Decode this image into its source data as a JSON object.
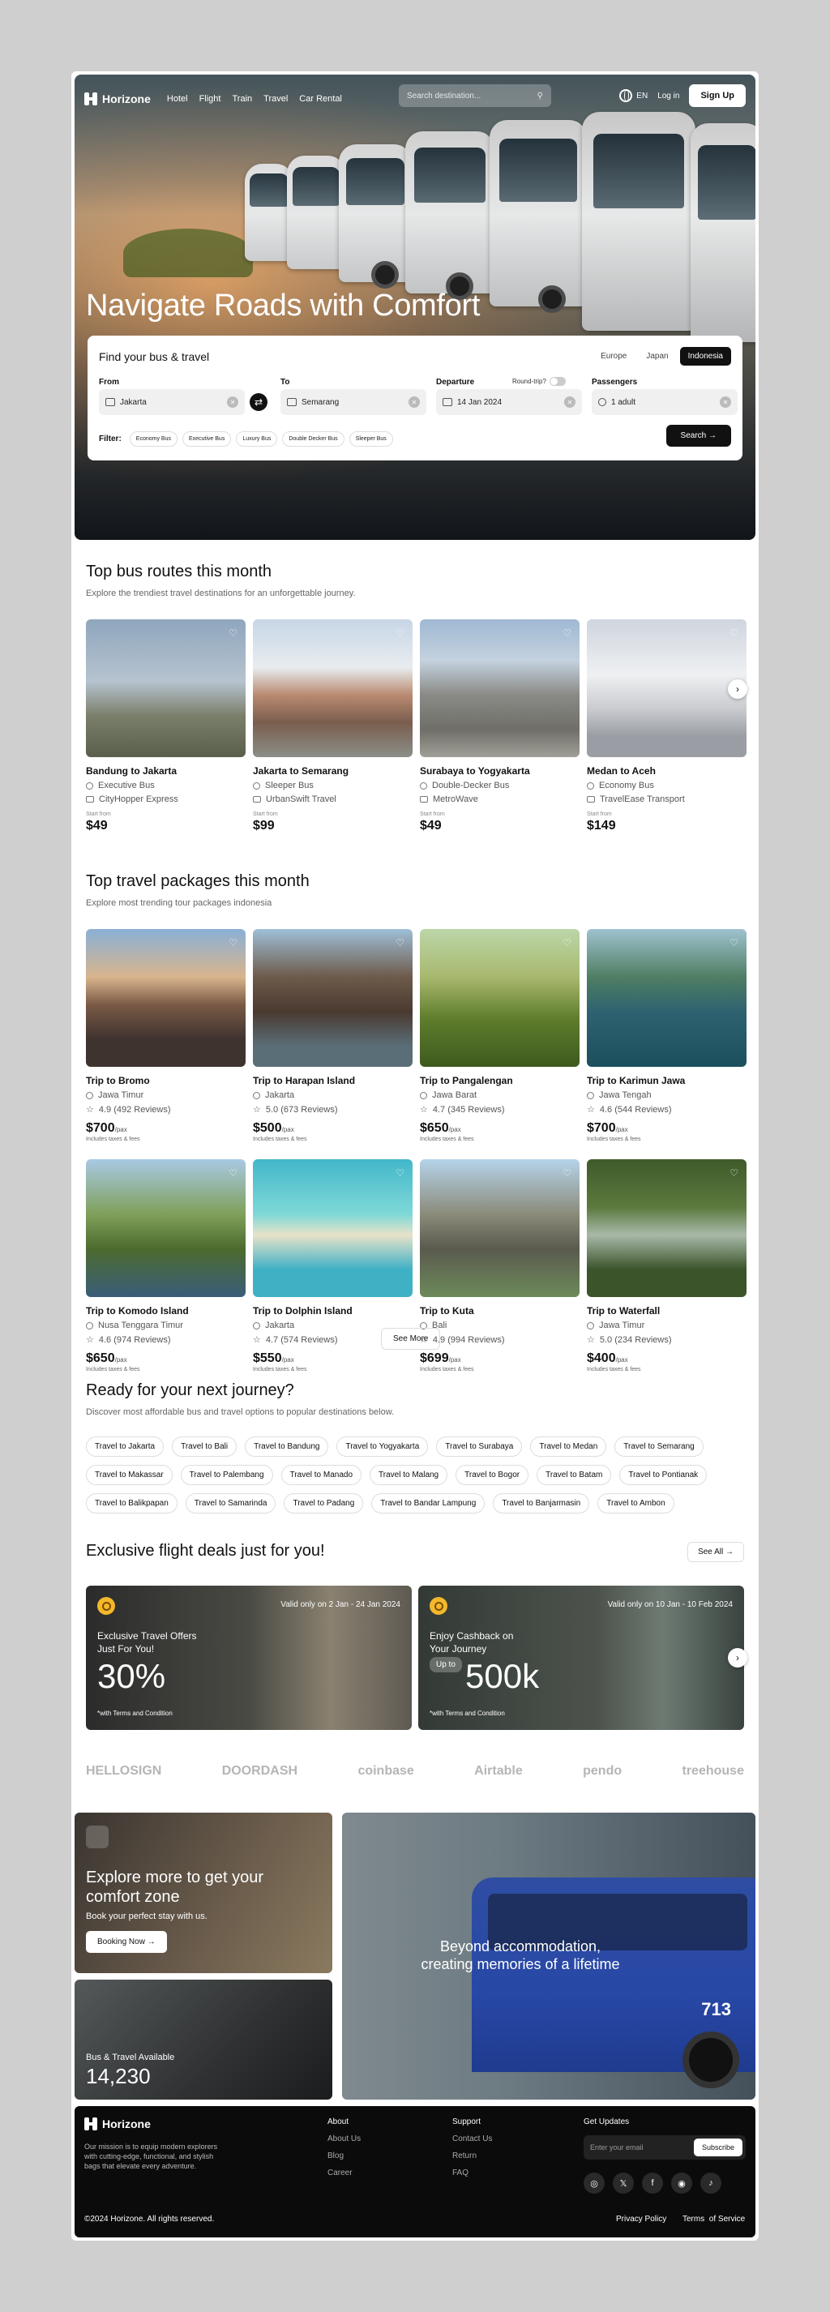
{
  "nav": {
    "brand": "Horizone",
    "links": [
      "Hotel",
      "Flight",
      "Train",
      "Travel",
      "Car Rental"
    ],
    "search_placeholder": "Search destination...",
    "lang": "EN",
    "login": "Log in",
    "signup": "Sign Up"
  },
  "hero": {
    "title": "Navigate Roads with Comfort"
  },
  "booking": {
    "title": "Find your bus & travel",
    "countries": [
      "Europe",
      "Japan",
      "Indonesia"
    ],
    "active_country": "Indonesia",
    "from_label": "From",
    "from_value": "Jakarta",
    "to_label": "To",
    "to_value": "Semarang",
    "departure_label": "Departure",
    "departure_value": "14 Jan 2024",
    "roundtrip_label": "Round-trip?",
    "passengers_label": "Passengers",
    "passengers_value": "1 adult",
    "filter_label": "Filter:",
    "filters": [
      "Economy Bus",
      "Executive Bus",
      "Luxury Bus",
      "Double Decker Bus",
      "Sleeper Bus"
    ],
    "search_btn": "Search"
  },
  "routes": {
    "title": "Top bus routes this month",
    "subtitle": "Explore the trendiest travel destinations for an unforgettable journey.",
    "items": [
      {
        "name": "Bandung to Jakarta",
        "class": "Executive Bus",
        "operator": "CityHopper Express",
        "start": "Start from",
        "price": "$49"
      },
      {
        "name": "Jakarta to Semarang",
        "class": "Sleeper Bus",
        "operator": "UrbanSwift Travel",
        "start": "Start from",
        "price": "$99"
      },
      {
        "name": "Surabaya to Yogyakarta",
        "class": "Double-Decker Bus",
        "operator": "MetroWave",
        "start": "Start from",
        "price": "$49"
      },
      {
        "name": "Medan to Aceh",
        "class": "Economy Bus",
        "operator": "TravelEase Transport",
        "start": "Start from",
        "price": "$149"
      }
    ]
  },
  "packages": {
    "title": "Top travel packages this month",
    "subtitle": "Explore most trending tour packages indonesia",
    "pax": "/pax",
    "taxes": "Includes taxes & fees",
    "items": [
      {
        "name": "Trip to Bromo",
        "loc": "Jawa Timur",
        "rating": "4.9 (492 Reviews)",
        "price": "$700"
      },
      {
        "name": "Trip to Harapan Island",
        "loc": "Jakarta",
        "rating": "5.0 (673 Reviews)",
        "price": "$500"
      },
      {
        "name": "Trip to Pangalengan",
        "loc": "Jawa Barat",
        "rating": "4.7 (345 Reviews)",
        "price": "$650"
      },
      {
        "name": "Trip to Karimun Jawa",
        "loc": "Jawa Tengah",
        "rating": "4.6 (544 Reviews)",
        "price": "$700"
      },
      {
        "name": "Trip to Komodo Island",
        "loc": "Nusa Tenggara Timur",
        "rating": "4.6 (974 Reviews)",
        "price": "$650"
      },
      {
        "name": "Trip to Dolphin Island",
        "loc": "Jakarta",
        "rating": "4.7 (574 Reviews)",
        "price": "$550"
      },
      {
        "name": "Trip to Kuta",
        "loc": "Bali",
        "rating": "4.9 (994 Reviews)",
        "price": "$699"
      },
      {
        "name": "Trip to Waterfall",
        "loc": "Jawa Timur",
        "rating": "5.0 (234 Reviews)",
        "price": "$400"
      }
    ],
    "see_more": "See More"
  },
  "journey": {
    "title": "Ready for your next journey?",
    "subtitle": "Discover most affordable bus and travel options to popular destinations below.",
    "chips": [
      "Travel to Jakarta",
      "Travel to Bali",
      "Travel to Bandung",
      "Travel to Yogyakarta",
      "Travel to Surabaya",
      "Travel to Medan",
      "Travel to Semarang",
      "Travel to Makassar",
      "Travel to Palembang",
      "Travel to Manado",
      "Travel to Malang",
      "Travel to Bogor",
      "Travel to Batam",
      "Travel to Pontianak",
      "Travel to Balikpapan",
      "Travel to Samarinda",
      "Travel to Padang",
      "Travel to Bandar Lampung",
      "Travel to Banjarmasin",
      "Travel to Ambon"
    ]
  },
  "deals": {
    "title": "Exclusive flight deals just for you!",
    "see_all": "See All",
    "items": [
      {
        "valid": "Valid only on 2 Jan - 24 Jan 2024",
        "text": "Exclusive Travel Offers Just For You!",
        "up_to": "",
        "big": "30%",
        "terms": "*with Terms and Condition"
      },
      {
        "valid": "Valid only on 10 Jan - 10 Feb 2024",
        "text": "Enjoy Cashback on Your Journey",
        "up_to": "Up to",
        "big": "500k",
        "terms": "*with Terms and Condition"
      }
    ]
  },
  "logos": [
    "HELLOSIGN",
    "DOORDASH",
    "coinbase",
    "Airtable",
    "pendo",
    "treehouse"
  ],
  "promo": {
    "explore_title": "Explore more to get your comfort zone",
    "explore_sub": "Book your perfect stay with us.",
    "booking_btn": "Booking Now",
    "available_label": "Bus & Travel Available",
    "available_count": "14,230",
    "beyond": "Beyond accommodation, creating memories of a lifetime",
    "bus_number": "713"
  },
  "footer": {
    "brand": "Horizone",
    "mission": "Our mission is to equip modern explorers with cutting-edge, functional, and stylish bags that elevate every adventure.",
    "about_title": "About",
    "about_links": [
      "About Us",
      "Blog",
      "Career"
    ],
    "support_title": "Support",
    "support_links": [
      "Contact Us",
      "Return",
      "FAQ"
    ],
    "updates_title": "Get Updates",
    "email_placeholder": "Enter your email",
    "subscribe": "Subscribe",
    "copyright": "©2024 Horizone. All rights reserved.",
    "privacy": "Privacy Policy",
    "terms": "Terms  of Service"
  }
}
